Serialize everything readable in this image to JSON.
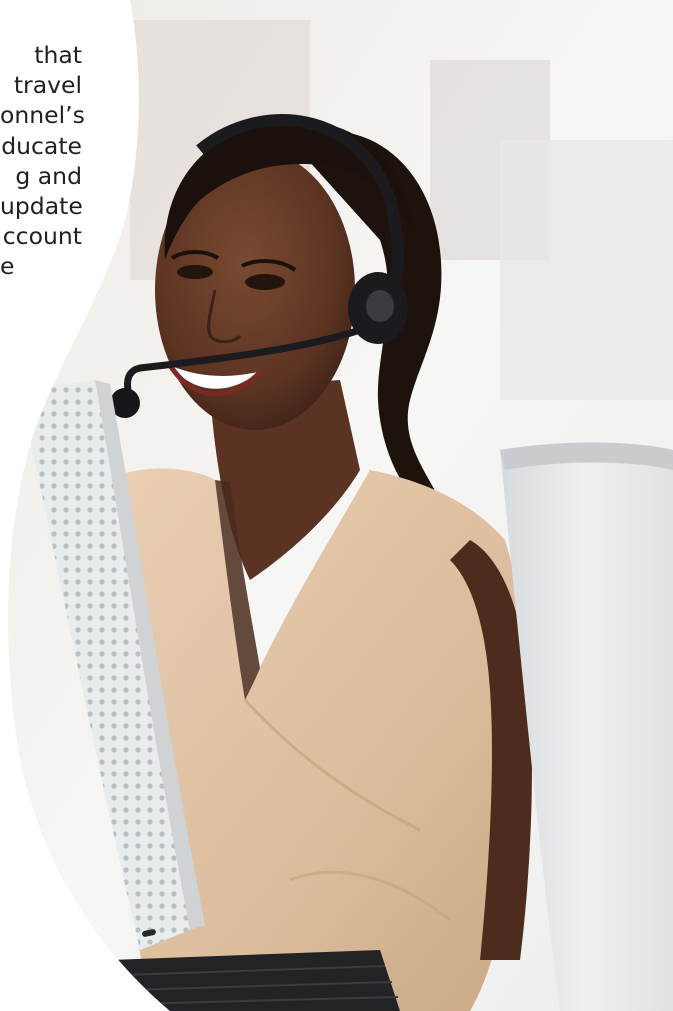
{
  "text_column": {
    "lines": [
      "that",
      "travel",
      "onnel’s",
      "ducate",
      "g  and",
      "update",
      "ccount",
      "e"
    ]
  },
  "photo": {
    "subject": "smiling-woman-with-headset",
    "colors": {
      "skin": "#5a3322",
      "blouse": "#e2c4a6",
      "monitor": "#e6e9ea",
      "background": "#f2f2f0",
      "headset": "#1b1b1f"
    }
  }
}
